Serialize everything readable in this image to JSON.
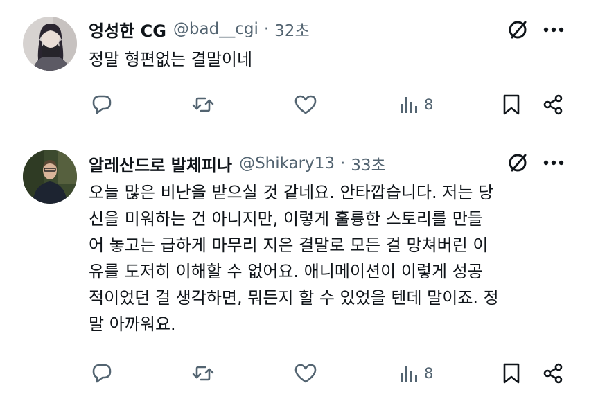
{
  "tweets": [
    {
      "name": "엉성한 CG",
      "handle": "@bad__cgi",
      "separator": "·",
      "time": "32초",
      "text": "정말 형편없는 결말이네",
      "views": "8"
    },
    {
      "name": "알레산드로 발체피나",
      "handle": "@Shikary13",
      "separator": "·",
      "time": "33초",
      "lines": [
        "오늘 많은 비난을 받으실 것 같네요. 안타깝습니다. 저는 당",
        "신을 미워하는 건 아니지만, 이렇게 훌륭한 스토리를 만들",
        "어 놓고는 급하게 마무리 지은 결말로 모든 걸 망쳐버린 이",
        "유를 도저히 이해할 수 없어요. 애니메이션이 이렇게 성공",
        "적이었던 걸 생각하면, 뭐든지 할 수 있었을 텐데 말이죠. 정",
        "말 아까워요."
      ],
      "views": "8"
    }
  ],
  "icons": {
    "reply": "reply-icon",
    "retweet": "retweet-icon",
    "like": "like-icon",
    "views": "views-icon",
    "bookmark": "bookmark-icon",
    "share": "share-icon",
    "grok": "grok-icon",
    "more": "more-icon"
  },
  "colors": {
    "text": "#0f1419",
    "secondary": "#536471",
    "divider": "#e6e9ec"
  }
}
